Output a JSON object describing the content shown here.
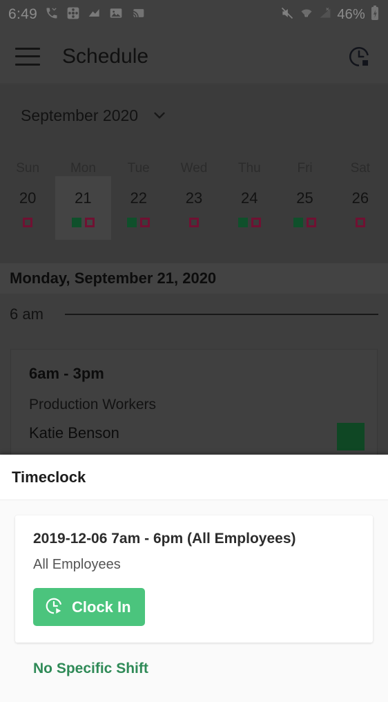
{
  "status_bar": {
    "clock": "6:49",
    "battery": "46%",
    "left_icons": [
      "missed-call-icon",
      "game-controller-icon",
      "chart-icon",
      "photo-icon",
      "cast-icon"
    ],
    "right_icons": [
      "mute-icon",
      "wifi-icon",
      "cell-signal-icon",
      "battery-icon"
    ]
  },
  "app_bar": {
    "menu_icon": "hamburger-menu-icon",
    "title": "Schedule",
    "action_icon": "timeclock-clock-icon"
  },
  "calendar": {
    "month_label": "September 2020",
    "month_chevron_icon": "chevron-down-icon",
    "weekday_headers": [
      "Sun",
      "Mon",
      "Tue",
      "Wed",
      "Thu",
      "Fri",
      "Sat"
    ],
    "days": [
      {
        "number": "20",
        "selected": false,
        "markers": [
          "pink"
        ]
      },
      {
        "number": "21",
        "selected": true,
        "markers": [
          "green",
          "pink"
        ]
      },
      {
        "number": "22",
        "selected": false,
        "markers": [
          "green",
          "pink"
        ]
      },
      {
        "number": "23",
        "selected": false,
        "markers": [
          "pink"
        ]
      },
      {
        "number": "24",
        "selected": false,
        "markers": [
          "green",
          "pink"
        ]
      },
      {
        "number": "25",
        "selected": false,
        "markers": [
          "green",
          "pink"
        ]
      },
      {
        "number": "26",
        "selected": false,
        "markers": [
          "pink"
        ]
      }
    ],
    "marker_colors": {
      "green": "#1b8a4b",
      "pink": "#c21e56"
    }
  },
  "day_view": {
    "header": "Monday, September 21, 2020",
    "hour_label": "6 am",
    "shift": {
      "time": "6am - 3pm",
      "role": "Production Workers",
      "person": "Katie Benson",
      "color": "#1b7a3e"
    }
  },
  "bottom_sheet": {
    "title": "Timeclock",
    "card": {
      "title": "2019-12-06 7am - 6pm (All Employees)",
      "subtitle": "All Employees",
      "button_label": "Clock In",
      "button_icon": "clock-play-icon",
      "button_color": "#4bc47d"
    },
    "no_specific_shift_label": "No Specific Shift",
    "link_color": "#2f8a57"
  }
}
